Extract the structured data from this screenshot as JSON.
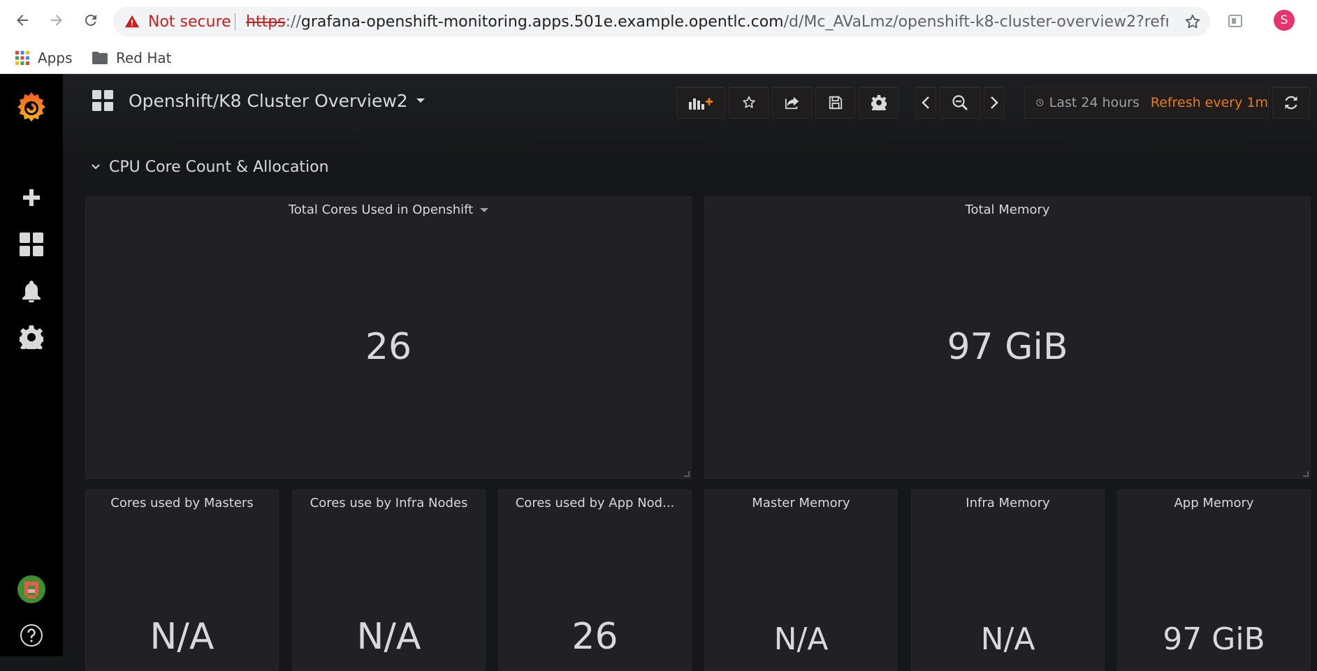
{
  "browser": {
    "security_label": "Not secure",
    "url_scheme": "https",
    "url_sep": "://",
    "url_host": "grafana-openshift-monitoring.apps.501e.example.opentlc.com",
    "url_path": "/d/Mc_AVaLmz/openshift-k8-cluster-overview2?refres...",
    "profile_initial": "S",
    "bookmarks": [
      {
        "label": "Apps",
        "icon": "apps-grid-icon"
      },
      {
        "label": "Red Hat",
        "icon": "folder-icon"
      }
    ]
  },
  "grafana": {
    "dashboard_title": "Openshift/K8 Cluster Overview2",
    "time_range": "Last 24 hours",
    "refresh_interval": "Refresh every 1m",
    "accent_color": "#eb7b18",
    "row_title": "CPU Core Count & Allocation",
    "panels_top": [
      {
        "title": "Total Cores Used in Openshift",
        "value": "26",
        "has_menu": true
      },
      {
        "title": "Total Memory",
        "value": "97 GiB"
      }
    ],
    "panels_bottom": [
      {
        "title": "Cores used by Masters",
        "value": "N/A"
      },
      {
        "title": "Cores use by Infra Nodes",
        "value": "N/A"
      },
      {
        "title": "Cores used by App Nod...",
        "value": "26"
      },
      {
        "title": "Master Memory",
        "value": "N/A"
      },
      {
        "title": "Infra Memory",
        "value": "N/A"
      },
      {
        "title": "App Memory",
        "value": "97 GiB"
      }
    ]
  }
}
